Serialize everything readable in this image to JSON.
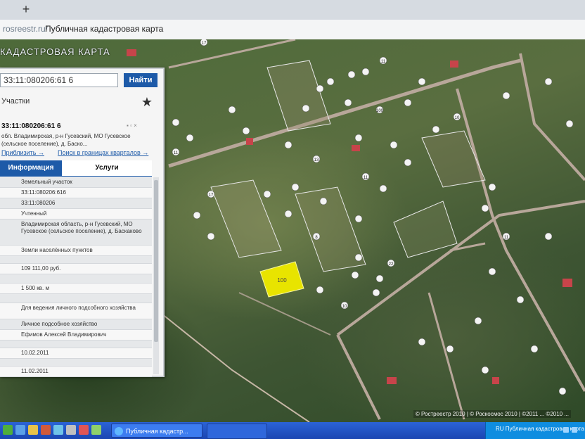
{
  "browser": {
    "new_tab_symbol": "+",
    "url": "rosreestr.ru/",
    "page_title": "Публичная кадастровая карта"
  },
  "map": {
    "title": "КАДАСТРОВАЯ КАРТА",
    "copyright": "© Ростреестр 2010 | © Роскосмос 2010 | ©2011 ... ©2010 ...",
    "labels": [
      "17",
      "11",
      "100",
      "10",
      "11",
      "13",
      "11",
      "17",
      "8",
      "22",
      "10",
      "11"
    ],
    "highlight_label": "100"
  },
  "panel": {
    "search_value": "33:11:080206:61 6",
    "search_button": "Найти",
    "results_label": "Участки",
    "parcel_number": "33:11:080206:61 6",
    "parcel_address": "обл. Владимирская, р-н Гусевский, МО Гусевское (сельское поселение), д. Баско...",
    "link_zoom": "Приблизить →",
    "link_neighbors": "Поиск в границах кварталов →",
    "tab_info": "Информация",
    "tab_services": "Услуги",
    "rows": [
      {
        "label": "",
        "value": "Земельный участок"
      },
      {
        "label": "",
        "value": "33:11:080206:616"
      },
      {
        "label": "",
        "value": "33:11:080206"
      },
      {
        "label": "",
        "value": "Учтенный"
      },
      {
        "label": "",
        "value": "Владимирская область, р-н Гусевский, МО Гусевское (сельское поселение), д. Баскаково"
      },
      {
        "label": "",
        "value": "Земли населённых пунктов"
      },
      {
        "label": "",
        "value": ""
      },
      {
        "label": "",
        "value": "109 111,00 руб."
      },
      {
        "label": "",
        "value": ""
      },
      {
        "label": "",
        "value": "1 500 кв. м"
      },
      {
        "label": "",
        "value": ""
      },
      {
        "label": "",
        "value": "Для ведения личного подсобного хозяйства"
      },
      {
        "label": "",
        "value": "Личное подсобное хозяйство"
      },
      {
        "label": "",
        "value": "Ефимов Алексей Владимирович"
      },
      {
        "label": "",
        "value": ""
      },
      {
        "label": "",
        "value": "10.02.2011"
      },
      {
        "label": "",
        "value": ""
      },
      {
        "label": "",
        "value": "11.02.2011"
      }
    ]
  },
  "taskbar": {
    "window_label": "Публичная кадастр...",
    "tray_text": "RU  Публичная кадастровая карта"
  }
}
